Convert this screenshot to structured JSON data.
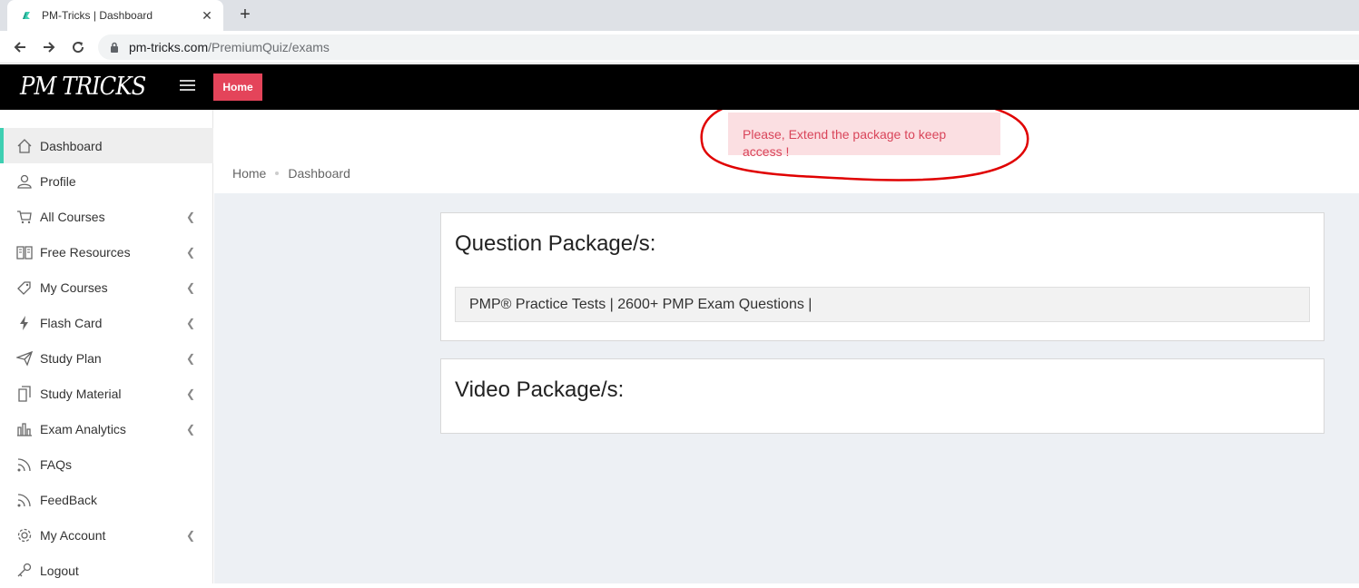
{
  "browser": {
    "tab_title": "PM-Tricks | Dashboard",
    "tab_close": "✕",
    "new_tab": "+",
    "url_host": "pm-tricks.com",
    "url_path": "/PremiumQuiz/exams"
  },
  "header": {
    "logo": "PM TRICKS",
    "home_button": "Home",
    "colors": {
      "bar": "#000000",
      "home_button": "#e4445a"
    }
  },
  "sidebar": {
    "accent": "#3ecfb2",
    "items": [
      {
        "label": "Dashboard",
        "icon": "home-icon",
        "has_chevron": false,
        "active": true
      },
      {
        "label": "Profile",
        "icon": "user-icon",
        "has_chevron": false
      },
      {
        "label": "All Courses",
        "icon": "cart-icon",
        "has_chevron": true
      },
      {
        "label": "Free Resources",
        "icon": "book-icon",
        "has_chevron": true
      },
      {
        "label": "My Courses",
        "icon": "tag-icon",
        "has_chevron": true
      },
      {
        "label": "Flash Card",
        "icon": "bolt-icon",
        "has_chevron": true
      },
      {
        "label": "Study Plan",
        "icon": "paper-plane-icon",
        "has_chevron": true
      },
      {
        "label": "Study Material",
        "icon": "copy-icon",
        "has_chevron": true
      },
      {
        "label": "Exam Analytics",
        "icon": "bar-chart-icon",
        "has_chevron": true
      },
      {
        "label": "FAQs",
        "icon": "rss-icon",
        "has_chevron": false
      },
      {
        "label": "FeedBack",
        "icon": "rss-icon",
        "has_chevron": false
      },
      {
        "label": "My Account",
        "icon": "gear-icon",
        "has_chevron": true
      },
      {
        "label": "Logout",
        "icon": "key-icon",
        "has_chevron": false
      }
    ]
  },
  "alert": {
    "message": "Please, Extend the package to keep access !",
    "colors": {
      "bg": "#fbdfe2",
      "text": "#d9455a",
      "annotation": "#e00000"
    }
  },
  "breadcrumb": {
    "home": "Home",
    "current": "Dashboard"
  },
  "question_packages": {
    "title": "Question Package/s:",
    "items": [
      "PMP® Practice Tests | 2600+ PMP Exam Questions |"
    ]
  },
  "video_packages": {
    "title": "Video Package/s:"
  }
}
